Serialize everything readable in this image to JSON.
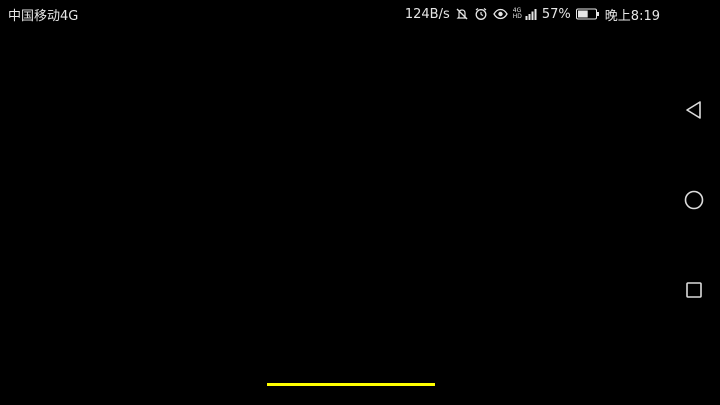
{
  "status_bar": {
    "carrier": "中国移动4G",
    "net_speed": "124B/s",
    "lte_top": "4G",
    "lte_bottom": "HD",
    "battery_percent": "57%",
    "time": "晚上8:19",
    "battery_level": 0.57
  },
  "icons": {
    "mute": "muted-bell-icon",
    "alarm": "alarm-clock-icon",
    "eye": "eye-comfort-icon",
    "signal": "signal-strength-icon",
    "battery": "battery-icon",
    "back": "back-triangle-icon",
    "home": "home-circle-icon",
    "recents": "recents-square-icon"
  },
  "loading": {
    "progress": 1.0,
    "color": "#ffff00"
  }
}
